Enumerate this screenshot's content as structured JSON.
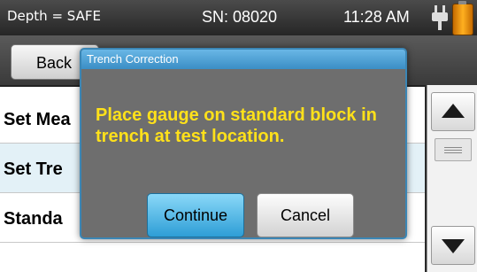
{
  "status_bar": {
    "depth": "Depth = SAFE",
    "serial": "SN: 08020",
    "time": "11:28 AM",
    "power_icon": "plug-icon",
    "battery_icon": "battery-icon"
  },
  "toolbar": {
    "back_label": "Back"
  },
  "list": {
    "items": [
      {
        "label": "Set Mea"
      },
      {
        "label": "Set Tre"
      },
      {
        "label": "Standa"
      }
    ]
  },
  "scrollbar": {
    "up_icon": "chevron-up-icon",
    "down_icon": "chevron-down-icon"
  },
  "dialog": {
    "title": "Trench Correction",
    "message": "Place gauge on standard block in trench at test location.",
    "continue_label": "Continue",
    "cancel_label": "Cancel",
    "title_color": "#3b8ec5",
    "message_color": "#ffe11a"
  }
}
